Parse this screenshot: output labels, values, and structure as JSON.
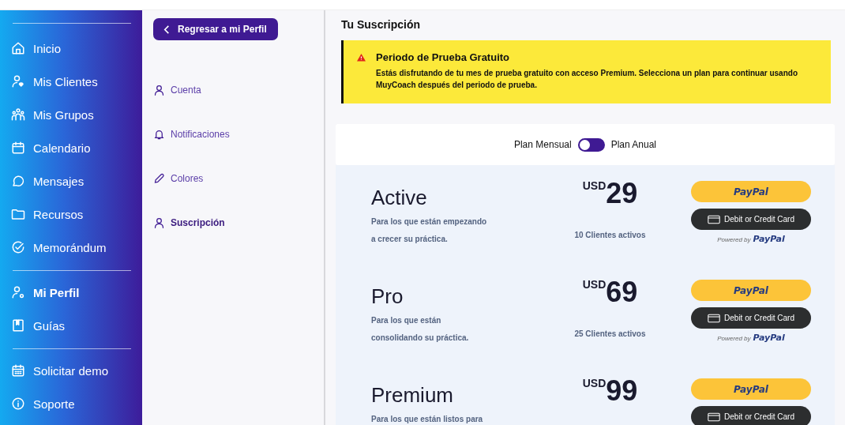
{
  "sidebar": {
    "items": [
      {
        "label": "Inicio",
        "selected": false
      },
      {
        "label": "Mis Clientes",
        "selected": false
      },
      {
        "label": "Mis Grupos",
        "selected": false
      },
      {
        "label": "Calendario",
        "selected": false
      },
      {
        "label": "Mensajes",
        "selected": false
      },
      {
        "label": "Recursos",
        "selected": false
      },
      {
        "label": "Memorándum",
        "selected": false
      },
      {
        "label": "Mi Perfil",
        "selected": true
      },
      {
        "label": "Guías",
        "selected": false
      },
      {
        "label": "Solicitar demo",
        "selected": false
      },
      {
        "label": "Soporte",
        "selected": false
      }
    ]
  },
  "subnav": {
    "back_button": "Regresar a mi Perfil",
    "items": [
      {
        "label": "Cuenta",
        "selected": false
      },
      {
        "label": "Notificaciones",
        "selected": false
      },
      {
        "label": "Colores",
        "selected": false
      },
      {
        "label": "Suscripción",
        "selected": true
      }
    ]
  },
  "main": {
    "title": "Tu Suscripción",
    "alert": {
      "title": "Periodo de Prueba Gratuito",
      "text": "Estás disfrutando de tu mes de prueba gratuito con acceso Premium. Selecciona un plan para continuar usando MuyCoach después del periodo de prueba."
    },
    "billing_toggle": {
      "left_label": "Plan Mensual",
      "right_label": "Plan Anual",
      "on": false
    },
    "plans": [
      {
        "name": "Active",
        "description": [
          "Para los que están empezando",
          "a crecer su práctica."
        ],
        "currency": "USD",
        "price": "29",
        "clients": "10 Clientes activos",
        "paypal": "PayPal",
        "card": "Debit or Credit Card",
        "powered_by": "Powered by",
        "powered_brand": "PayPal"
      },
      {
        "name": "Pro",
        "description": [
          "Para los que están",
          "consolidando su práctica."
        ],
        "currency": "USD",
        "price": "69",
        "clients": "25 Clientes activos",
        "paypal": "PayPal",
        "card": "Debit or Credit Card",
        "powered_by": "Powered by",
        "powered_brand": "PayPal"
      },
      {
        "name": "Premium",
        "description": [
          "Para los que están listos para"
        ],
        "currency": "USD",
        "price": "99",
        "paypal": "PayPal",
        "card": "Debit or Credit Card"
      }
    ]
  }
}
